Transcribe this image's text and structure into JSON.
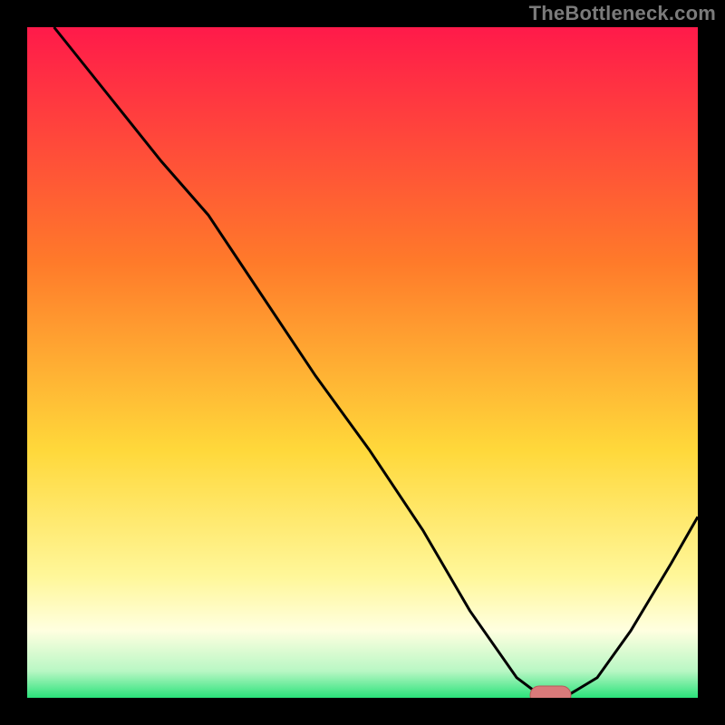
{
  "watermark": "TheBottleneck.com",
  "colors": {
    "frame": "#000000",
    "curve": "#000000",
    "marker_fill": "#d97a7a",
    "marker_stroke": "#b85a5a",
    "grad_top": "#ff1a4a",
    "grad_mid1": "#ff7a2a",
    "grad_mid2": "#ffd83a",
    "grad_mid3": "#fff79a",
    "grad_bottom": "#2ae27a"
  },
  "chart_data": {
    "type": "line",
    "title": "",
    "xlabel": "",
    "ylabel": "",
    "xlim": [
      0,
      100
    ],
    "ylim": [
      0,
      100
    ],
    "grid": false,
    "legend": false,
    "note": "Bottleneck curve: y is mismatch (0 = perfect match, 100 = worst). Values estimated from pixel positions.",
    "series": [
      {
        "name": "bottleneck_curve",
        "x": [
          4,
          12,
          20,
          27,
          35,
          43,
          51,
          59,
          66,
          73,
          77,
          80,
          85,
          90,
          96,
          100
        ],
        "values": [
          100,
          90,
          80,
          72,
          60,
          48,
          37,
          25,
          13,
          3,
          0,
          0,
          3,
          10,
          20,
          27
        ]
      }
    ],
    "marker": {
      "note": "Highlighted optimal region along x where mismatch is ~0",
      "x_start": 75,
      "x_end": 81,
      "y": 0
    },
    "background_gradient": {
      "note": "Vertical heat gradient fills plot interior (red top → green bottom)",
      "stops_pct": [
        0,
        35,
        63,
        82,
        90,
        96,
        100
      ],
      "colors": [
        "#ff1a4a",
        "#ff7a2a",
        "#ffd83a",
        "#fff79a",
        "#ffffe0",
        "#b9f7c4",
        "#2ae27a"
      ]
    }
  }
}
